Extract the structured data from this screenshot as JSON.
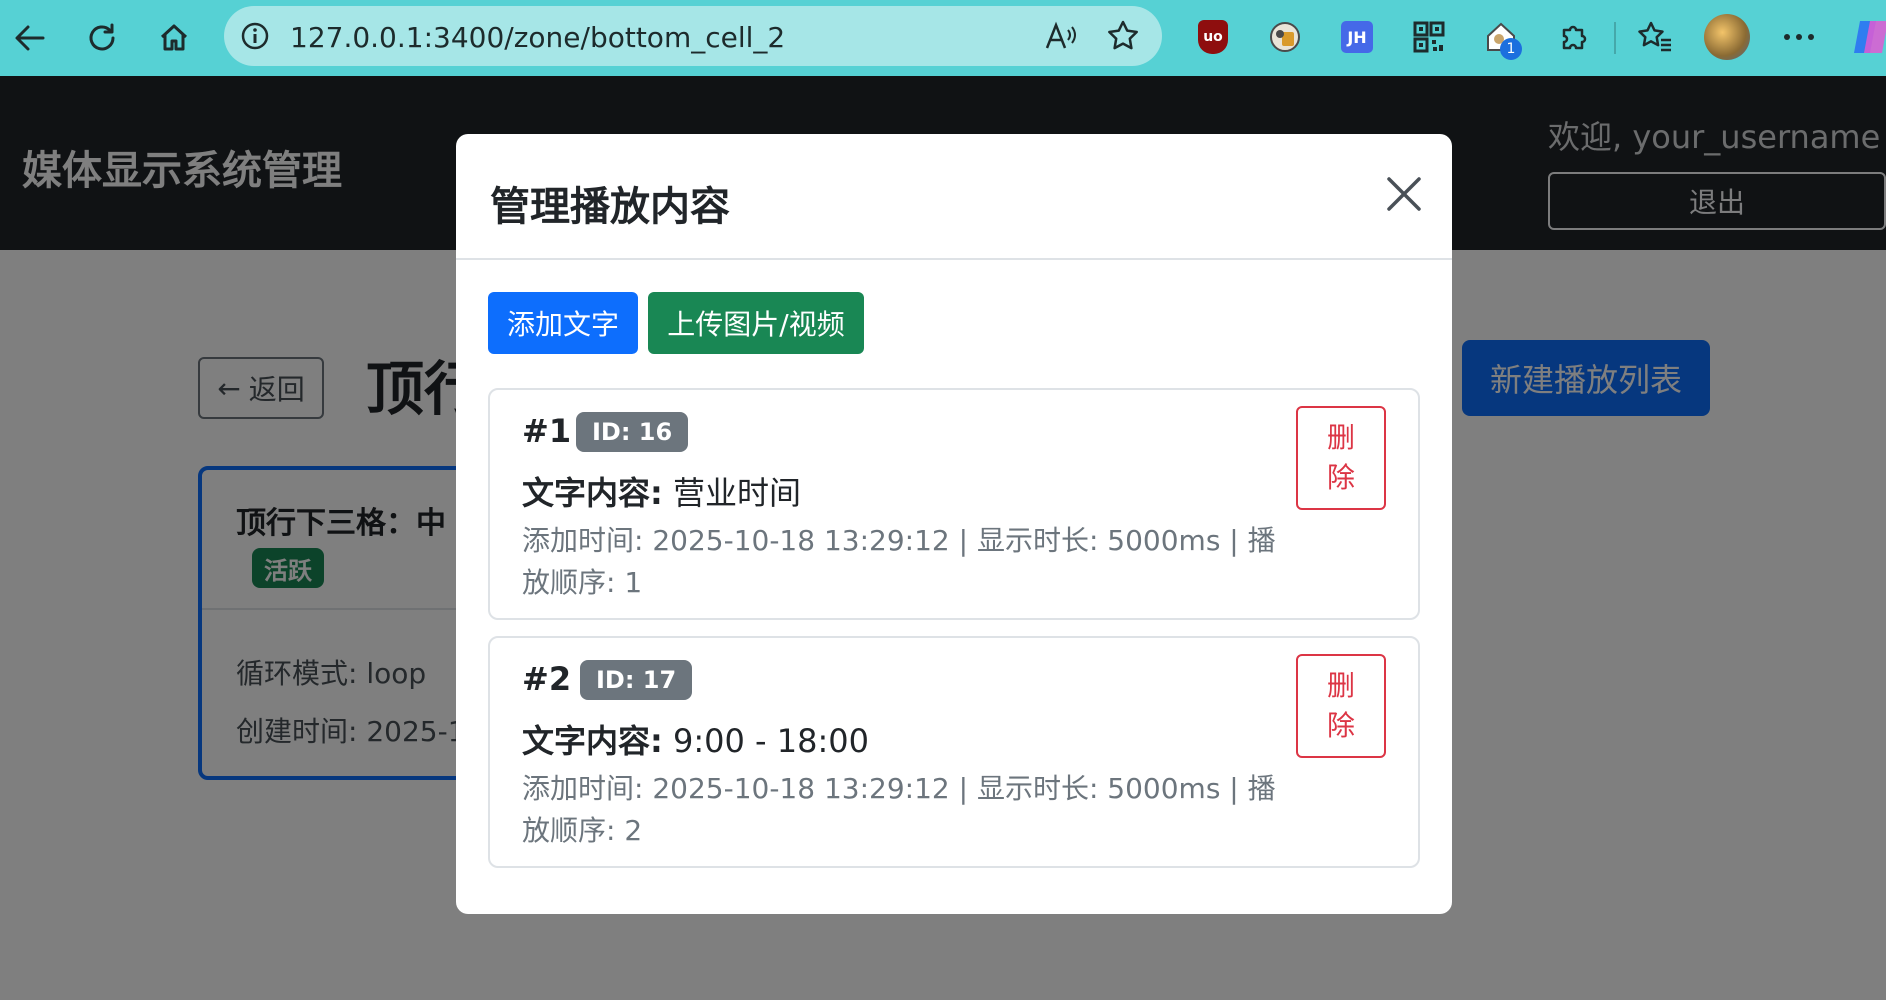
{
  "browser": {
    "url": "127.0.0.1:3400/zone/bottom_cell_2",
    "icons": [
      "back-arrow-icon",
      "reload-icon",
      "home-icon",
      "info-icon",
      "read-aloud-icon",
      "favorite-star-icon",
      "ublock-icon",
      "password-extension-icon",
      "jh-extension-icon",
      "qr-code-icon",
      "home-extension-icon",
      "extensions-puzzle-icon",
      "favorites-icon",
      "profile-avatar",
      "more-dots-icon",
      "copilot-icon"
    ],
    "ublock_label": "uo",
    "jh_label": "JH",
    "notification_badge": "1"
  },
  "header": {
    "brand": "媒体显示系统管理",
    "welcome": "欢迎, your_username",
    "logout_label": "退出"
  },
  "page": {
    "back_label": "返回",
    "title": "顶行",
    "new_playlist_label": "新建播放列表",
    "playlist": {
      "name": "顶行下三格：中",
      "status": "活跃",
      "mode": "循环模式: loop",
      "created": "创建时间: 2025-1"
    }
  },
  "modal": {
    "title": "管理播放内容",
    "add_text_label": "添加文字",
    "upload_label": "上传图片/视频",
    "items": [
      {
        "num": "#1",
        "id": "ID: 16",
        "content_label": "文字内容:",
        "content": "营业时间",
        "meta": "添加时间: 2025-10-18 13:29:12 | 显示时长: 5000ms | 播放顺序: 1",
        "delete_label": "删除"
      },
      {
        "num": "#2",
        "id": "ID: 17",
        "content_label": "文字内容:",
        "content": "9:00 - 18:00",
        "meta": "添加时间: 2025-10-18 13:29:12 | 显示时长: 5000ms | 播放顺序: 2",
        "delete_label": "删除"
      }
    ]
  },
  "colors": {
    "browser_bar": "#56d1d4",
    "primary": "#0d6efd",
    "success": "#198754",
    "danger": "#dc3545",
    "secondary": "#6c757d",
    "dark": "#212529"
  }
}
